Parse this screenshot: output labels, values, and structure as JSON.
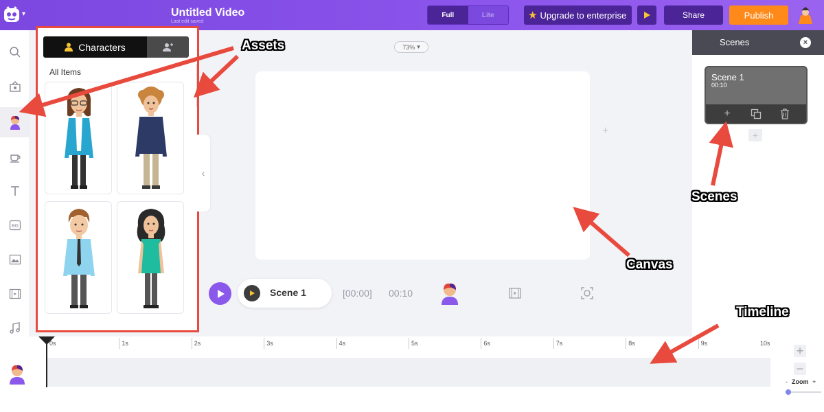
{
  "app": {
    "title": "Untitled Video",
    "subtitle": "Last edit saved",
    "mode_full": "Full",
    "mode_lite": "Lite",
    "upgrade_label": "Upgrade to enterprise",
    "share_label": "Share",
    "publish_label": "Publish"
  },
  "sidebar": {
    "items": [
      {
        "icon": "search-icon"
      },
      {
        "icon": "properties-icon"
      },
      {
        "icon": "character-icon",
        "active": true
      },
      {
        "icon": "coffee-cup-icon"
      },
      {
        "icon": "text-icon"
      },
      {
        "icon": "background-icon",
        "label": "BG"
      },
      {
        "icon": "image-icon"
      },
      {
        "icon": "video-icon"
      },
      {
        "icon": "music-icon"
      }
    ]
  },
  "assets": {
    "tab_characters": "Characters",
    "section_title": "All Items",
    "characters": [
      {
        "name": "woman-glasses-blue-blazer"
      },
      {
        "name": "man-curly-navy-sweater"
      },
      {
        "name": "man-blue-shirt-tie"
      },
      {
        "name": "woman-teal-top"
      }
    ]
  },
  "canvas": {
    "zoom_level": "73%"
  },
  "playback": {
    "scene_label": "Scene 1",
    "time_start": "[00:00]",
    "time_end": "00:10"
  },
  "scenes_panel": {
    "title": "Scenes",
    "scenes": [
      {
        "title": "Scene 1",
        "duration": "00:10"
      }
    ]
  },
  "timeline": {
    "ticks": [
      "0s",
      "1s",
      "2s",
      "3s",
      "4s",
      "5s",
      "6s",
      "7s",
      "8s",
      "9s",
      "10s"
    ],
    "zoom_label": "Zoom",
    "zoom_minus": "-",
    "zoom_plus": "+"
  },
  "annotations": {
    "assets": "Assets",
    "scenes": "Scenes",
    "canvas": "Canvas",
    "timeline": "Timeline"
  },
  "colors": {
    "brand_purple": "#8a58ea",
    "publish_orange": "#ff8a1a",
    "annotation_red": "#e84a3e"
  }
}
